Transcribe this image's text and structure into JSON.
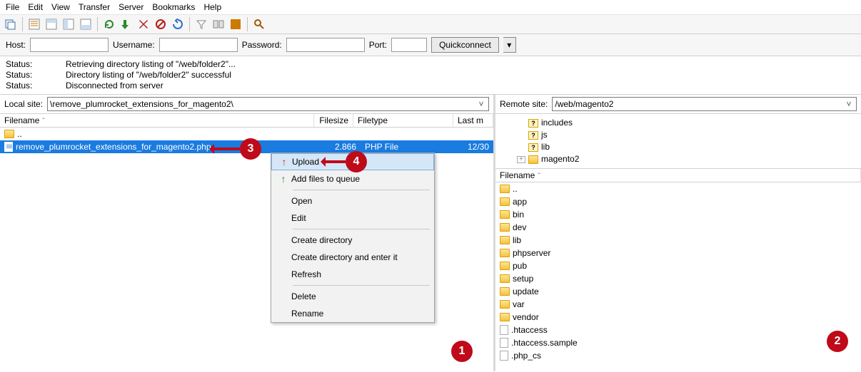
{
  "menu": {
    "items": [
      "File",
      "Edit",
      "View",
      "Transfer",
      "Server",
      "Bookmarks",
      "Help"
    ]
  },
  "conn": {
    "host_label": "Host:",
    "username_label": "Username:",
    "password_label": "Password:",
    "port_label": "Port:",
    "quickconnect": "Quickconnect"
  },
  "status": [
    {
      "label": "Status:",
      "text": "Retrieving directory listing of \"/web/folder2\"..."
    },
    {
      "label": "Status:",
      "text": "Directory listing of \"/web/folder2\" successful"
    },
    {
      "label": "Status:",
      "text": "Disconnected from server"
    }
  ],
  "local": {
    "site_label": "Local site:",
    "path": "\\remove_plumrocket_extensions_for_magento2\\",
    "columns": {
      "filename": "Filename",
      "filesize": "Filesize",
      "filetype": "Filetype",
      "lastmod": "Last m"
    },
    "rows": [
      {
        "name": "..",
        "type": "up"
      },
      {
        "name": "remove_plumrocket_extensions_for_magento2.php",
        "size": "2.866",
        "ftype": "PHP File",
        "mod": "12/30"
      }
    ]
  },
  "remote": {
    "site_label": "Remote site:",
    "path": "/web/magento2",
    "tree": [
      {
        "name": "includes"
      },
      {
        "name": "js"
      },
      {
        "name": "lib"
      },
      {
        "name": "magento2",
        "folder": true,
        "expandable": true
      }
    ],
    "col_filename": "Filename",
    "files": [
      {
        "name": "..",
        "type": "up"
      },
      {
        "name": "app",
        "type": "folder"
      },
      {
        "name": "bin",
        "type": "folder"
      },
      {
        "name": "dev",
        "type": "folder"
      },
      {
        "name": "lib",
        "type": "folder"
      },
      {
        "name": "phpserver",
        "type": "folder"
      },
      {
        "name": "pub",
        "type": "folder"
      },
      {
        "name": "setup",
        "type": "folder"
      },
      {
        "name": "update",
        "type": "folder"
      },
      {
        "name": "var",
        "type": "folder"
      },
      {
        "name": "vendor",
        "type": "folder"
      },
      {
        "name": ".htaccess",
        "type": "file"
      },
      {
        "name": ".htaccess.sample",
        "type": "file"
      },
      {
        "name": ".php_cs",
        "type": "file"
      }
    ]
  },
  "ctx": {
    "upload": "Upload",
    "addqueue": "Add files to queue",
    "open": "Open",
    "edit": "Edit",
    "createdir": "Create directory",
    "createdirenter": "Create directory and enter it",
    "refresh": "Refresh",
    "delete": "Delete",
    "rename": "Rename"
  },
  "badges": {
    "b1": "1",
    "b2": "2",
    "b3": "3",
    "b4": "4"
  }
}
